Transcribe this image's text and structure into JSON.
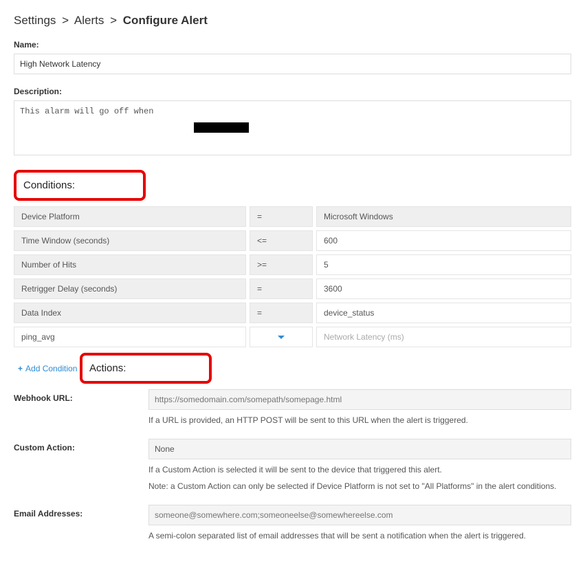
{
  "breadcrumb": {
    "l1": "Settings",
    "l2": "Alerts",
    "current": "Configure Alert"
  },
  "name": {
    "label": "Name:",
    "value": "High Network Latency"
  },
  "description": {
    "label": "Description:",
    "value": "This alarm will go off when"
  },
  "conditions": {
    "label": "Conditions:",
    "rows": [
      {
        "key": "Device Platform",
        "op": "=",
        "val": "Microsoft Windows",
        "valBg": "gray"
      },
      {
        "key": "Time Window (seconds)",
        "op": "<=",
        "val": "600",
        "valBg": "white"
      },
      {
        "key": "Number of Hits",
        "op": ">=",
        "val": "5",
        "valBg": "white"
      },
      {
        "key": "Retrigger Delay (seconds)",
        "op": "=",
        "val": "3600",
        "valBg": "white"
      },
      {
        "key": "Data Index",
        "op": "=",
        "val": "device_status",
        "valBg": "white"
      }
    ],
    "customRow": {
      "key": "ping_avg",
      "valPlaceholder": "Network Latency (ms)"
    },
    "addLabel": "Add Condition"
  },
  "actions": {
    "label": "Actions:",
    "webhook": {
      "label": "Webhook URL:",
      "placeholder": "https://somedomain.com/somepath/somepage.html",
      "help": "If a URL is provided, an HTTP POST will be sent to this URL when the alert is triggered."
    },
    "customAction": {
      "label": "Custom Action:",
      "selected": "None",
      "help1": "If a Custom Action is selected it will be sent to the device that triggered this alert.",
      "help2": "Note: a Custom Action can only be selected if Device Platform is not set to \"All Platforms\" in the alert conditions."
    },
    "email": {
      "label": "Email Addresses:",
      "placeholder": "someone@somewhere.com;someoneelse@somewhereelse.com",
      "help": "A semi-colon separated list of email addresses that will be sent a notification when the alert is triggered."
    }
  }
}
